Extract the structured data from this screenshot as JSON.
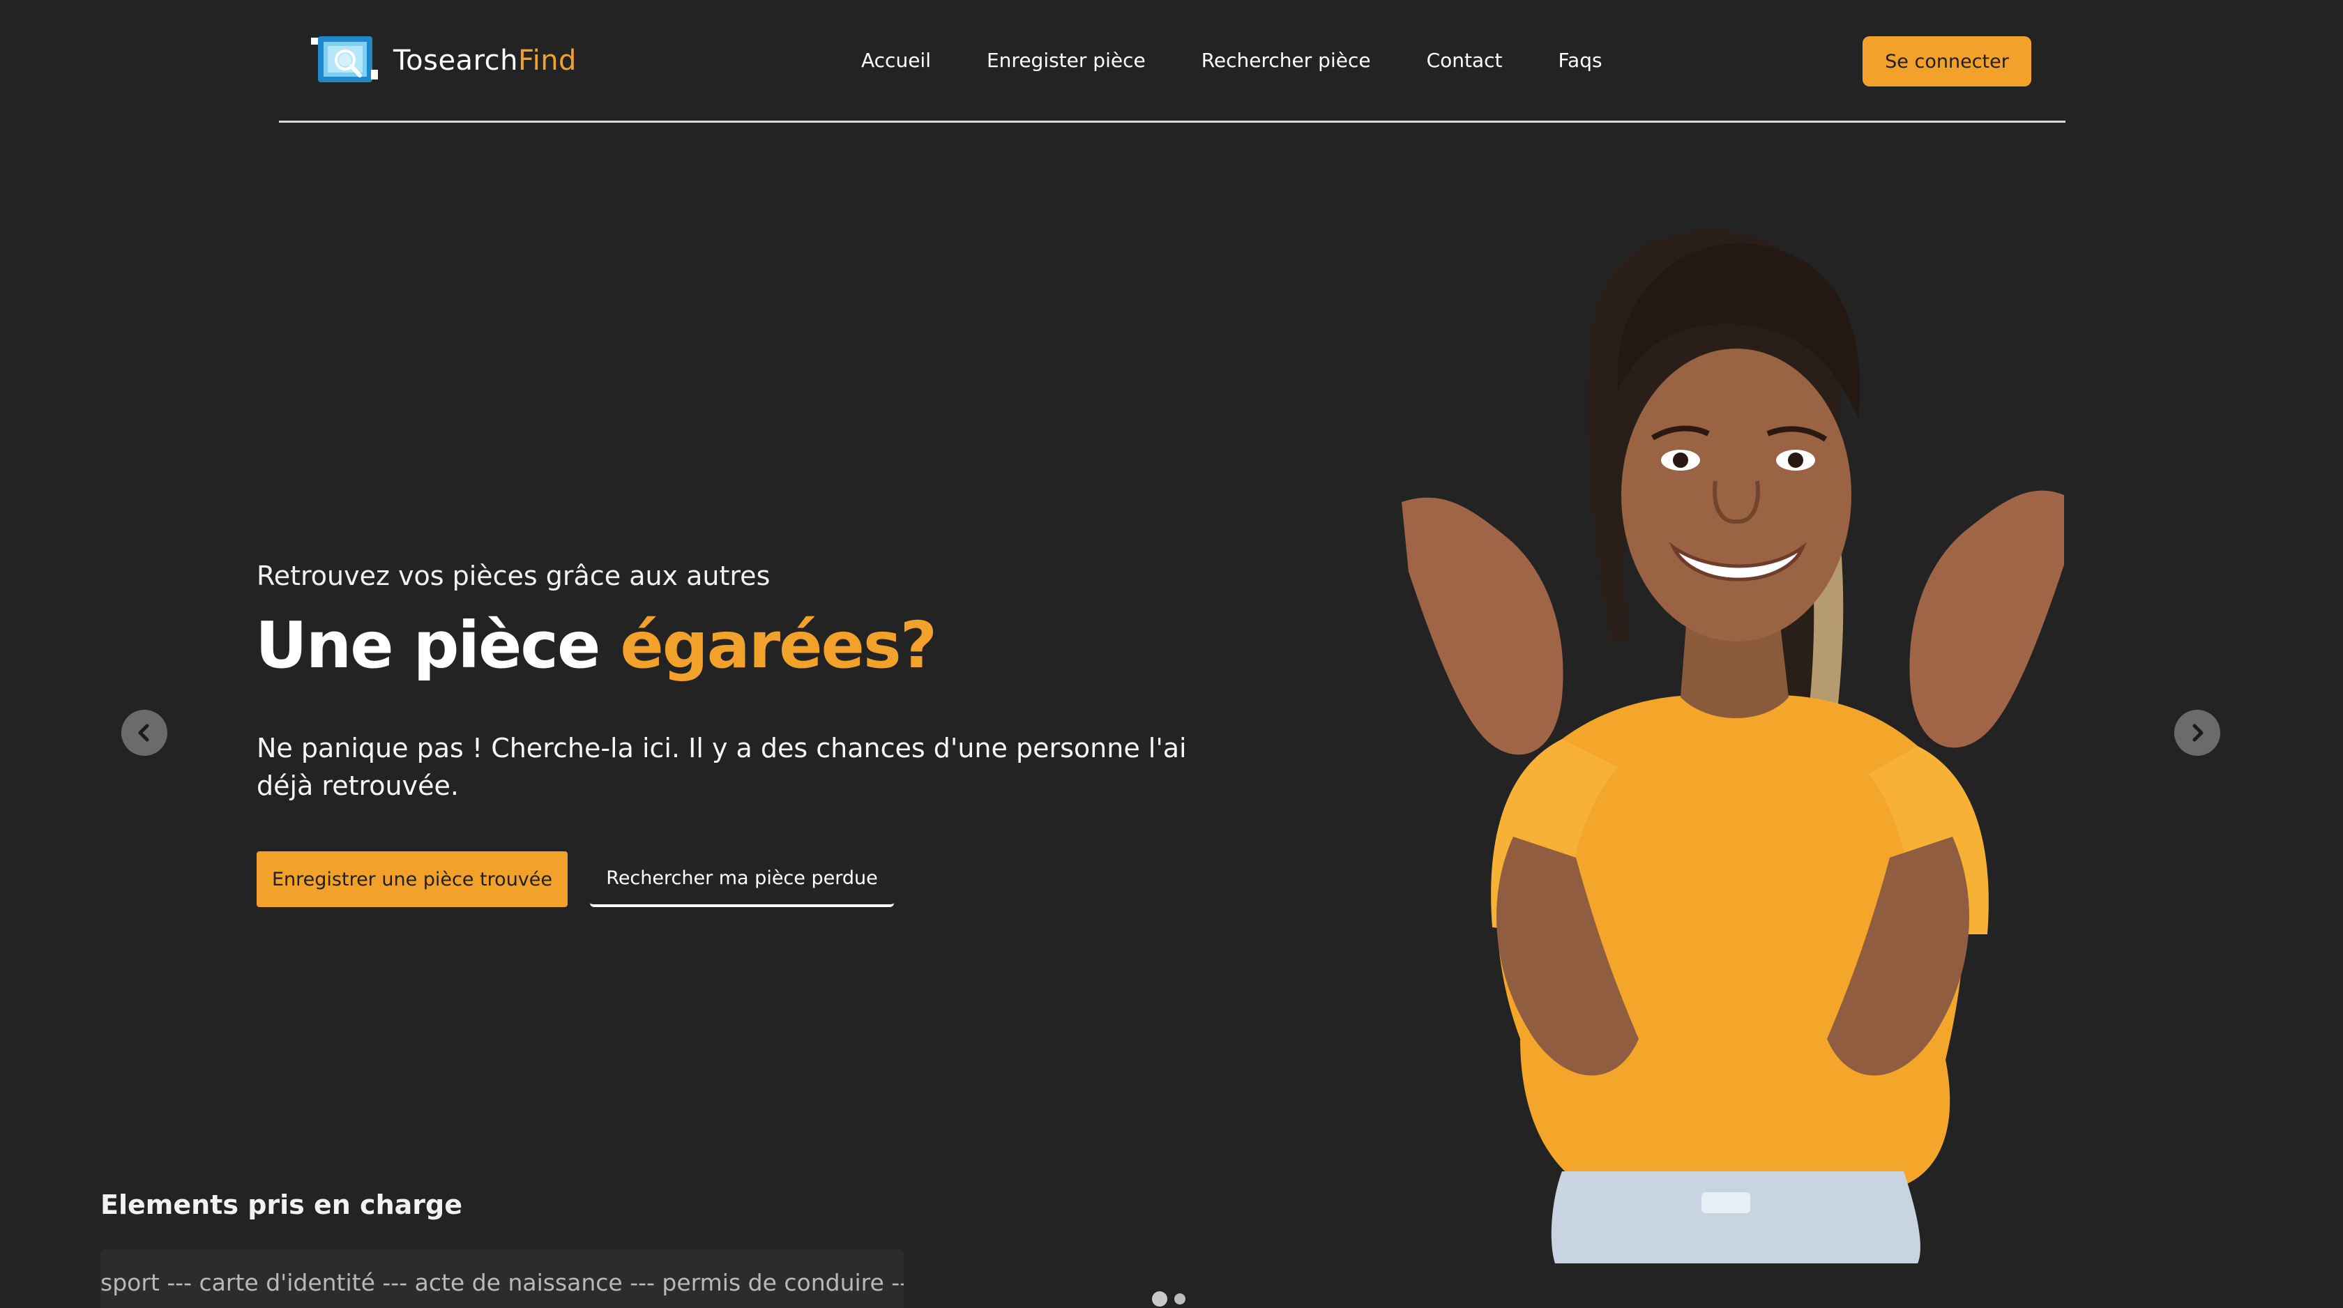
{
  "header": {
    "brand_main": "Tosearch",
    "brand_accent": "Find",
    "nav": [
      "Accueil",
      "Enregister pièce",
      "Rechercher pièce",
      "Contact",
      "Faqs"
    ],
    "login_label": "Se connecter"
  },
  "hero": {
    "subtitle": "Retrouvez vos pièces grâce aux autres",
    "title_main": "Une pièce",
    "title_accent": "égarées?",
    "description": "Ne panique pas ! Cherche-la ici. Il y a des chances d'une personne l'ai déjà retrouvée.",
    "primary_button": "Enregistrer une pièce trouvée",
    "secondary_button": "Rechercher ma pièce perdue"
  },
  "elements": {
    "title": "Elements pris en charge",
    "marquee_text": "sport --- carte d'identité --- acte de naissance --- permis de conduire ---Dip"
  },
  "colors": {
    "background": "#232323",
    "accent": "#f2a12b",
    "text": "#ffffff"
  },
  "icons": {
    "logo": "search-document-icon",
    "prev": "chevron-left-icon",
    "next": "chevron-right-icon"
  },
  "carousel": {
    "slides": 2,
    "active": 1
  }
}
